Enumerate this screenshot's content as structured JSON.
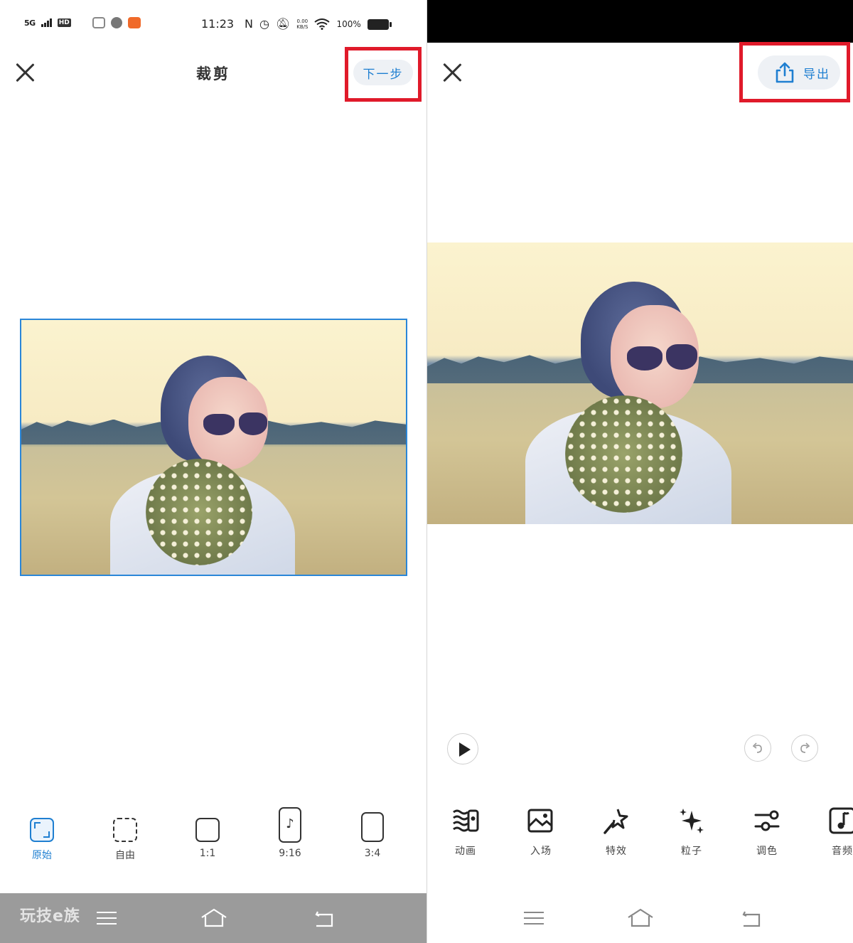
{
  "left_screen": {
    "status_bar": {
      "network": "5G",
      "hd_badge": "HD",
      "time": "11:23",
      "net_speed_top": "0.00",
      "net_speed_bottom": "KB/S",
      "battery": "100%"
    },
    "header": {
      "title": "裁剪",
      "next_label": "下一步"
    },
    "aspect_options": [
      {
        "label": "原始",
        "active": true
      },
      {
        "label": "自由",
        "active": false
      },
      {
        "label": "1:1",
        "active": false
      },
      {
        "label": "9:16",
        "active": false
      },
      {
        "label": "3:4",
        "active": false
      }
    ],
    "watermark": "玩技e族"
  },
  "right_screen": {
    "header": {
      "export_label": "导出"
    },
    "tools": [
      {
        "label": "动画",
        "icon": "animation-icon"
      },
      {
        "label": "入场",
        "icon": "entrance-icon"
      },
      {
        "label": "特效",
        "icon": "effects-icon"
      },
      {
        "label": "粒子",
        "icon": "particles-icon"
      },
      {
        "label": "调色",
        "icon": "color-adjust-icon"
      },
      {
        "label": "音频",
        "icon": "audio-icon"
      }
    ]
  },
  "colors": {
    "accent": "#1f7fd1",
    "highlight": "#e01a2a",
    "nav_bar_left": "#9b9b9b"
  }
}
